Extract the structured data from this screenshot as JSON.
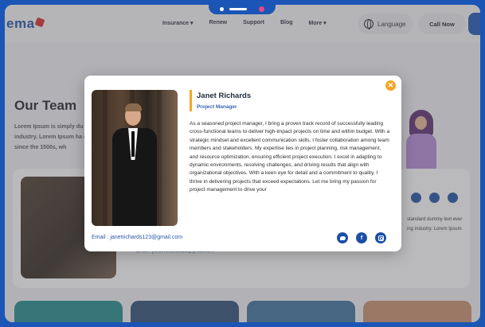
{
  "header": {
    "logo_text": "ema",
    "nav": [
      {
        "label": "Insurance",
        "has_dropdown": true
      },
      {
        "label": "Renew",
        "has_dropdown": false
      },
      {
        "label": "Support",
        "has_dropdown": false
      },
      {
        "label": "Blog",
        "has_dropdown": false
      },
      {
        "label": "More",
        "has_dropdown": true
      }
    ],
    "language_label": "Language",
    "call_now_label": "Call Now"
  },
  "page": {
    "title": "Our Team",
    "description": "Lorem Ipsum is simply du industry. Lorem Ipsum ha ever since the 1500s, wh",
    "background_card": {
      "text": "standard dummy text ever ing industry. Lorem Ipsum",
      "email": "Email : janetrichards123@gmail.com"
    }
  },
  "modal": {
    "close_icon": "close-icon",
    "name": "Janet Richards",
    "role": "Project Manager",
    "bio": "As a seasoned project manager, I bring a proven track record of successfully leading cross-functional teams to deliver high-impact projects on time and within budget. With a strategic mindset and excellent communication skills, I foster collaboration among team members and stakeholders. My expertise lies in project planning, risk management, and resource optimization, ensuring efficient project execution. I excel in adapting to dynamic environments, resolving challenges, and driving results that align with organizational objectives. With a keen eye for detail and a commitment to quality, I thrive in delivering projects that exceed expectations. Let me bring my passion for project management to drive your",
    "email": "Email : janetrichards123@gmail.com",
    "socials": [
      {
        "name": "twitter-icon",
        "glyph": ""
      },
      {
        "name": "facebook-icon",
        "glyph": "f"
      },
      {
        "name": "instagram-icon",
        "glyph": ""
      }
    ]
  },
  "colors": {
    "brand_blue": "#1c4fa5",
    "accent_orange": "#f5a623",
    "frame_blue": "#1b55b5"
  }
}
